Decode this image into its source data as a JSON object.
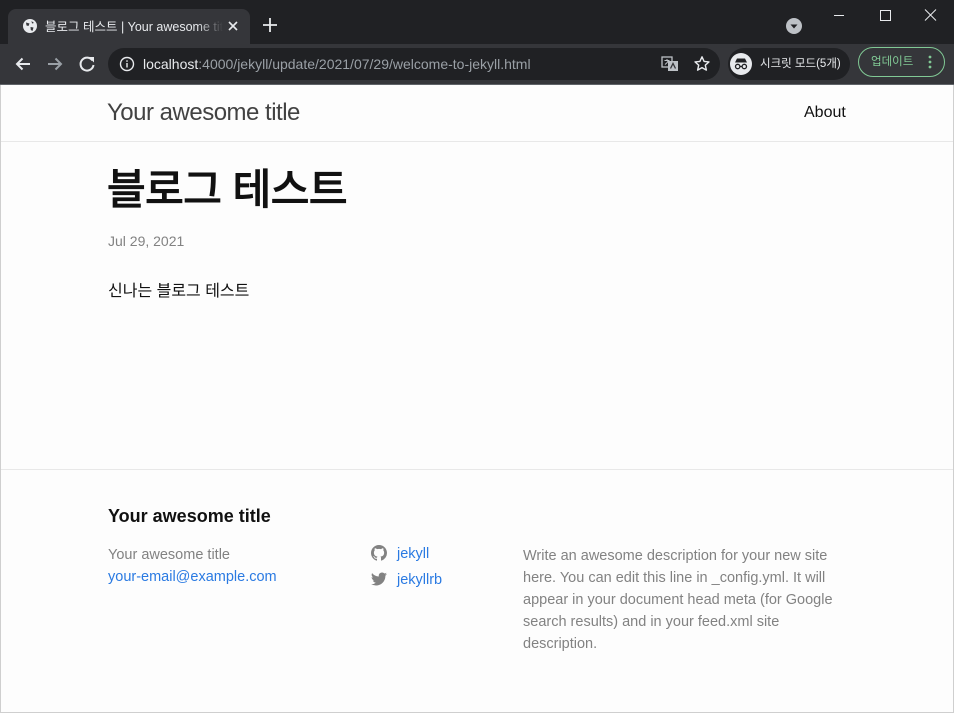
{
  "browser": {
    "tab": {
      "title": "블로그 테스트 | Your awesome title"
    },
    "url": {
      "host": "localhost",
      "rest": ":4000/jekyll/update/2021/07/29/welcome-to-jekyll.html"
    },
    "incognito_label": "시크릿 모드(5개)",
    "update_label": "업데이트",
    "icons": [
      "globe-icon",
      "close-icon",
      "plus-icon",
      "tab-search-icon",
      "minimize-icon",
      "maximize-icon",
      "close-window-icon",
      "back-arrow-icon",
      "forward-arrow-icon",
      "reload-icon",
      "info-icon",
      "translate-icon",
      "star-icon",
      "incognito-icon",
      "more-vert-icon"
    ],
    "colors": {
      "titlebar": "#202124",
      "toolbar": "#35363a",
      "update_accent": "#81c995"
    }
  },
  "site": {
    "header": {
      "title": "Your awesome title",
      "nav": [
        {
          "label": "About"
        }
      ]
    },
    "post": {
      "title": "블로그 테스트",
      "date": "Jul 29, 2021",
      "body": "신나는 블로그 테스트"
    },
    "footer": {
      "heading": "Your awesome title",
      "name": "Your awesome title",
      "email": "your-email@example.com",
      "social": [
        {
          "icon": "github-icon",
          "label": "jekyll"
        },
        {
          "icon": "twitter-icon",
          "label": "jekyllrb"
        }
      ],
      "description": "Write an awesome description for your new site here. You can edit this line in _config.yml. It will appear in your document head meta (for Google search results) and in your feed.xml site description."
    },
    "colors": {
      "link": "#2a7ae2",
      "muted": "#828282",
      "text": "#111111"
    }
  }
}
